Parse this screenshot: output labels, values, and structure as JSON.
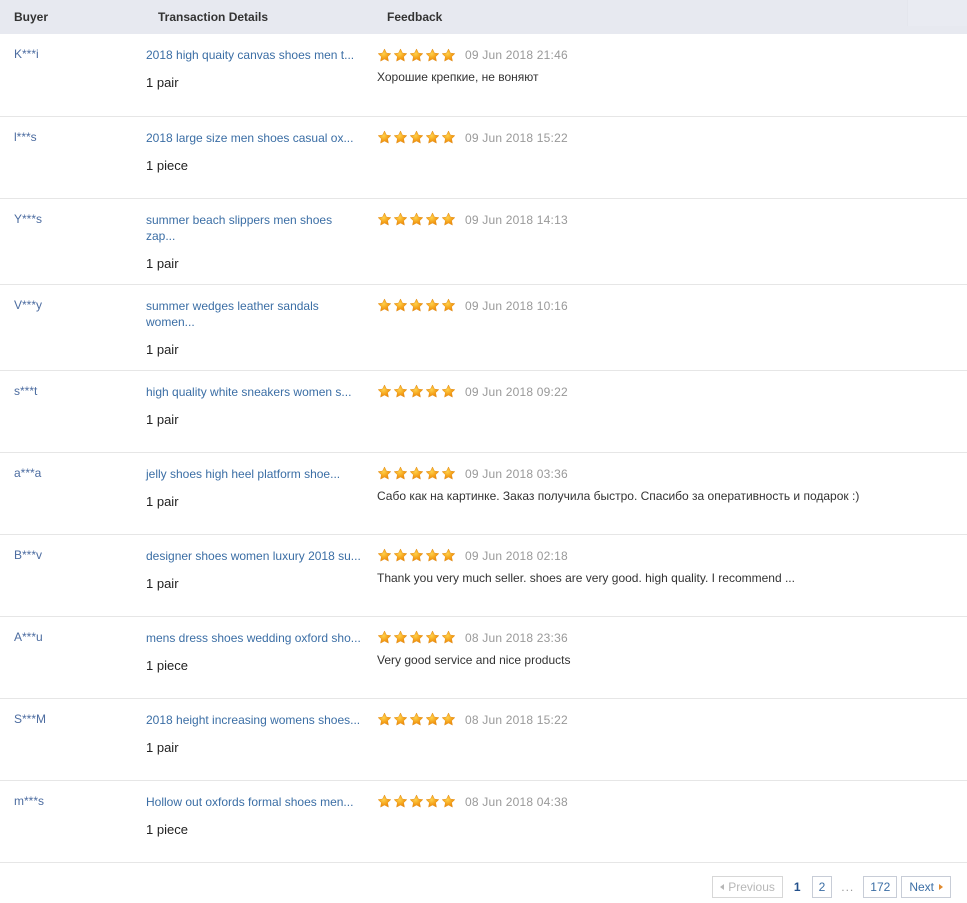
{
  "table": {
    "columns": [
      {
        "key": "buyer",
        "label": "Buyer"
      },
      {
        "key": "transaction",
        "label": "Transaction Details"
      },
      {
        "key": "feedback",
        "label": "Feedback"
      }
    ],
    "rows": [
      {
        "buyer": "K***i",
        "product": "2018 high quaity canvas shoes men t...",
        "quantity": "1 pair",
        "rating": 5,
        "date": "09 Jun 2018 21:46",
        "comment": "Хорошие крепкие, не воняют"
      },
      {
        "buyer": "l***s",
        "product": "2018 large size men shoes casual ox...",
        "quantity": "1 piece",
        "rating": 5,
        "date": "09 Jun 2018 15:22",
        "comment": ""
      },
      {
        "buyer": "Y***s",
        "product": "summer beach slippers men shoes zap...",
        "quantity": "1 pair",
        "rating": 5,
        "date": "09 Jun 2018 14:13",
        "comment": ""
      },
      {
        "buyer": "V***y",
        "product": "summer wedges leather sandals women...",
        "quantity": "1 pair",
        "rating": 5,
        "date": "09 Jun 2018 10:16",
        "comment": ""
      },
      {
        "buyer": "s***t",
        "product": "high quality white sneakers women s...",
        "quantity": "1 pair",
        "rating": 5,
        "date": "09 Jun 2018 09:22",
        "comment": ""
      },
      {
        "buyer": "a***a",
        "product": "jelly shoes high heel platform shoe...",
        "quantity": "1 pair",
        "rating": 5,
        "date": "09 Jun 2018 03:36",
        "comment": "Сабо как на картинке. Заказ получила быстро. Спасибо за оперативность и подарок :)"
      },
      {
        "buyer": "B***v",
        "product": "designer shoes women luxury 2018 su...",
        "quantity": "1 pair",
        "rating": 5,
        "date": "09 Jun 2018 02:18",
        "comment": "Thank you very much seller. shoes are very good. high quality. I recommend ..."
      },
      {
        "buyer": "A***u",
        "product": "mens dress shoes wedding oxford sho...",
        "quantity": "1 piece",
        "rating": 5,
        "date": "08 Jun 2018 23:36",
        "comment": "Very good service and nice products"
      },
      {
        "buyer": "S***M",
        "product": "2018 height increasing womens shoes...",
        "quantity": "1 pair",
        "rating": 5,
        "date": "08 Jun 2018 15:22",
        "comment": ""
      },
      {
        "buyer": "m***s",
        "product": "Hollow out oxfords formal shoes men...",
        "quantity": "1 piece",
        "rating": 5,
        "date": "08 Jun 2018 04:38",
        "comment": ""
      }
    ]
  },
  "pagination": {
    "previous_label": "Previous",
    "next_label": "Next",
    "ellipsis": "...",
    "current_page": "1",
    "pages": [
      "2",
      "172"
    ],
    "previous_enabled": false
  },
  "colors": {
    "header_bg": "#e7e9f0",
    "link": "#3b6ea5",
    "star": "#f5a31a",
    "date": "#999999",
    "row_border": "#e6e6e6",
    "pager_active": "#24518c"
  }
}
